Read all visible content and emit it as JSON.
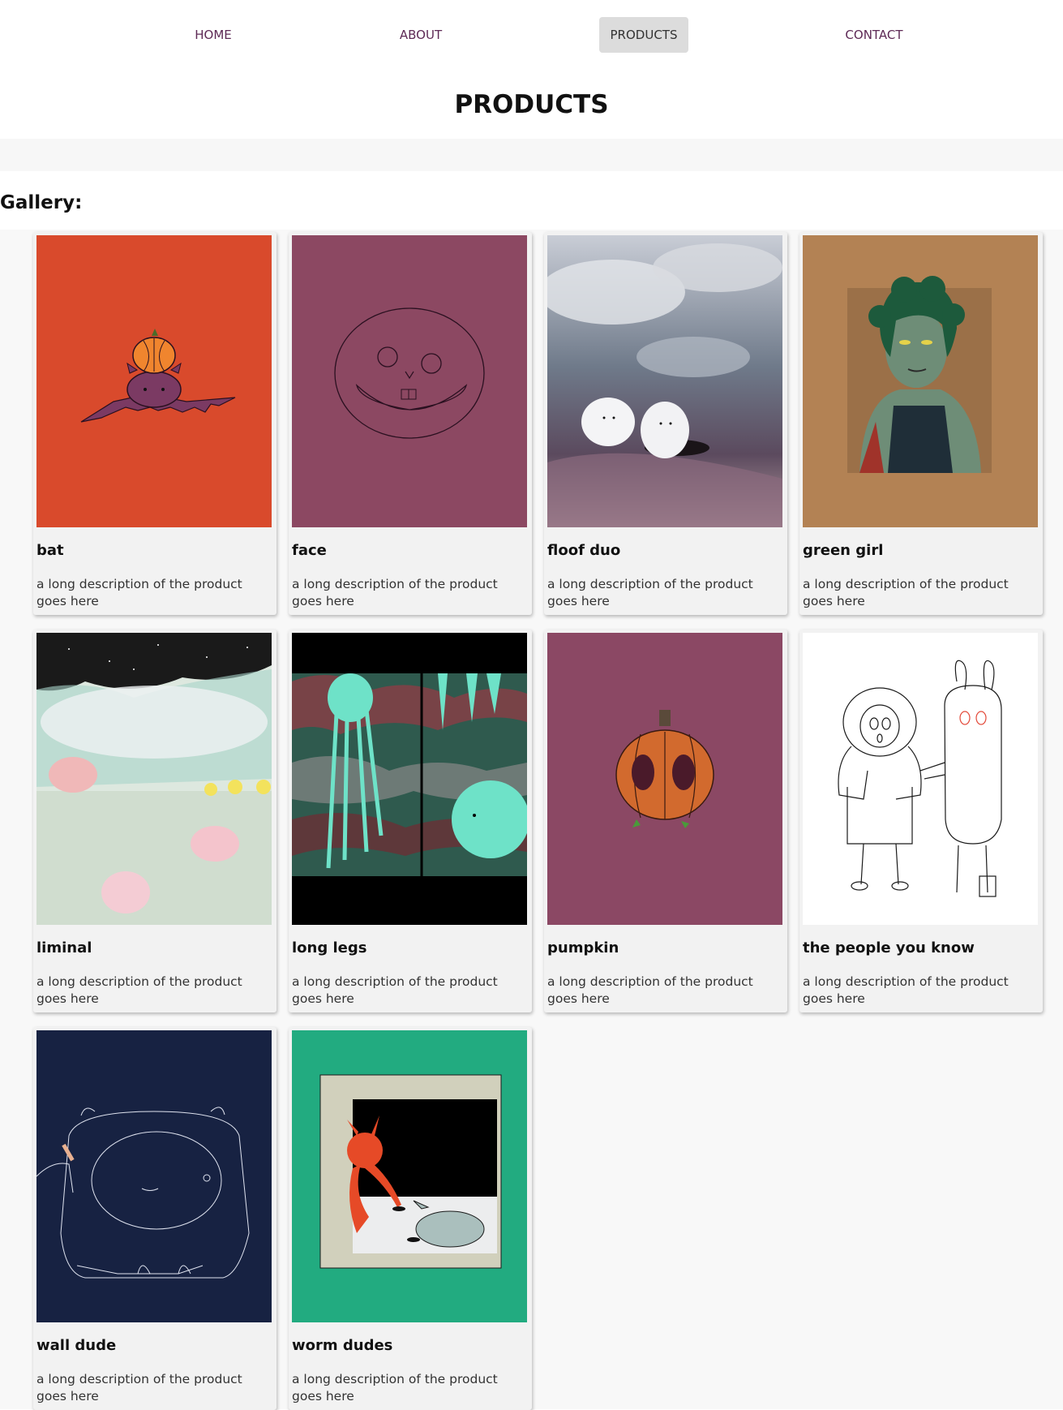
{
  "nav": {
    "items": [
      {
        "label": "HOME"
      },
      {
        "label": "ABOUT"
      },
      {
        "label": "PRODUCTS"
      },
      {
        "label": "CONTACT"
      }
    ],
    "active": "PRODUCTS"
  },
  "page": {
    "title": "PRODUCTS",
    "gallery_heading": "Gallery:"
  },
  "products": [
    {
      "title": "bat",
      "description": "a long description of the product goes here",
      "image_icon": "bat-pumpkin-illustration",
      "bg_color": "#d94a2c"
    },
    {
      "title": "face",
      "description": "a long description of the product goes here",
      "image_icon": "smiling-face-illustration",
      "bg_color": "#8c4862"
    },
    {
      "title": "floof duo",
      "description": "a long description of the product goes here",
      "image_icon": "fluffy-creatures-painting",
      "bg_color": "#9aa4b2"
    },
    {
      "title": "green girl",
      "description": "a long description of the product goes here",
      "image_icon": "green-girl-portrait",
      "bg_color": "#b38254"
    },
    {
      "title": "liminal",
      "description": "a long description of the product goes here",
      "image_icon": "liminal-creatures-painting",
      "bg_color": "#dce8df"
    },
    {
      "title": "long legs",
      "description": "a long description of the product goes here",
      "image_icon": "long-legs-creature-illustration",
      "bg_color": "#000000"
    },
    {
      "title": "pumpkin",
      "description": "a long description of the product goes here",
      "image_icon": "pumpkin-illustration",
      "bg_color": "#8b4864"
    },
    {
      "title": "the people you know",
      "description": "a long description of the product goes here",
      "image_icon": "line-drawing-characters",
      "bg_color": "#ffffff"
    },
    {
      "title": "wall dude",
      "description": "a long description of the product goes here",
      "image_icon": "wall-creature-line-drawing",
      "bg_color": "#172242"
    },
    {
      "title": "worm dudes",
      "description": "a long description of the product goes here",
      "image_icon": "worm-creatures-illustration",
      "bg_color": "#22ab80"
    }
  ]
}
